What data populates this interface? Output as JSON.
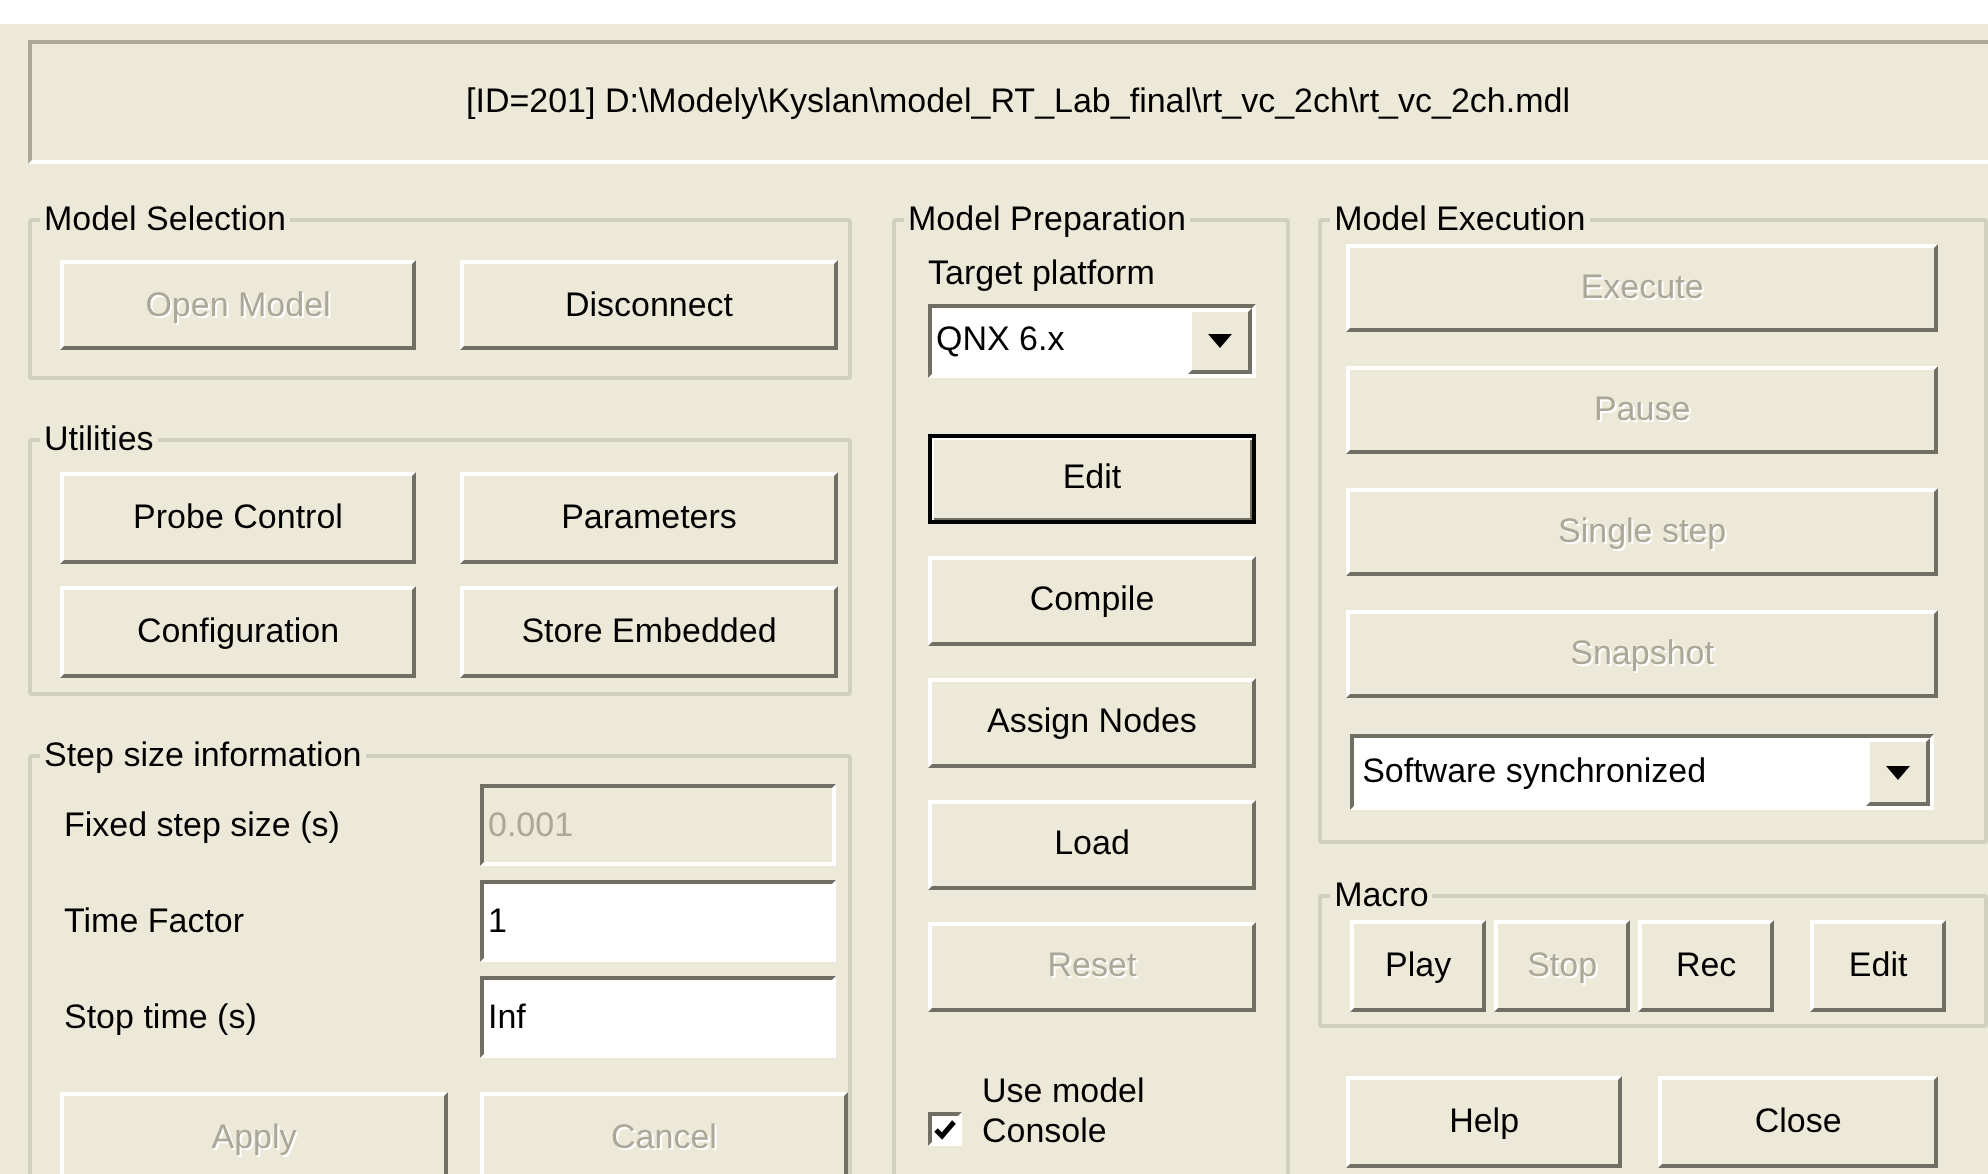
{
  "path_bar": {
    "text": "[ID=201]  D:\\Modely\\Kyslan\\model_RT_Lab_final\\rt_vc_2ch\\rt_vc_2ch.mdl"
  },
  "model_selection": {
    "title": "Model Selection",
    "buttons": [
      {
        "label": "Open Model",
        "disabled": true
      },
      {
        "label": "Disconnect",
        "disabled": false
      }
    ]
  },
  "utilities": {
    "title": "Utilities",
    "buttons": [
      {
        "label": "Probe Control",
        "disabled": false
      },
      {
        "label": "Parameters",
        "disabled": false
      },
      {
        "label": "Configuration",
        "disabled": false
      },
      {
        "label": "Store Embedded",
        "disabled": false
      }
    ]
  },
  "step_size": {
    "title": "Step size information",
    "fields": [
      {
        "label": "Fixed step size (s)",
        "value": "0.001",
        "disabled": true
      },
      {
        "label": "Time Factor",
        "value": "1",
        "disabled": false
      },
      {
        "label": "Stop time (s)",
        "value": "Inf",
        "disabled": false
      }
    ],
    "buttons": [
      {
        "label": "Apply",
        "disabled": true
      },
      {
        "label": "Cancel",
        "disabled": true
      }
    ]
  },
  "model_preparation": {
    "title": "Model Preparation",
    "platform_label": "Target platform",
    "platform": "QNX 6.x",
    "buttons": [
      {
        "label": "Edit",
        "disabled": false,
        "default": true
      },
      {
        "label": "Compile",
        "disabled": false,
        "default": false
      },
      {
        "label": "Assign Nodes",
        "disabled": false,
        "default": false
      },
      {
        "label": "Load",
        "disabled": false,
        "default": false
      },
      {
        "label": "Reset",
        "disabled": true,
        "default": false
      }
    ],
    "use_console": {
      "label": "Use model Console",
      "checked": true
    }
  },
  "model_execution": {
    "title": "Model Execution",
    "buttons": [
      {
        "label": "Execute",
        "disabled": true
      },
      {
        "label": "Pause",
        "disabled": true
      },
      {
        "label": "Single step",
        "disabled": true
      },
      {
        "label": "Snapshot",
        "disabled": true
      }
    ],
    "sync_mode": "Software synchronized"
  },
  "macro": {
    "title": "Macro",
    "buttons": [
      {
        "label": "Play",
        "disabled": false
      },
      {
        "label": "Stop",
        "disabled": true
      },
      {
        "label": "Rec",
        "disabled": false
      },
      {
        "label": "Edit",
        "disabled": false
      }
    ]
  },
  "dialog_buttons": [
    {
      "label": "Help",
      "disabled": false
    },
    {
      "label": "Close",
      "disabled": false
    }
  ]
}
